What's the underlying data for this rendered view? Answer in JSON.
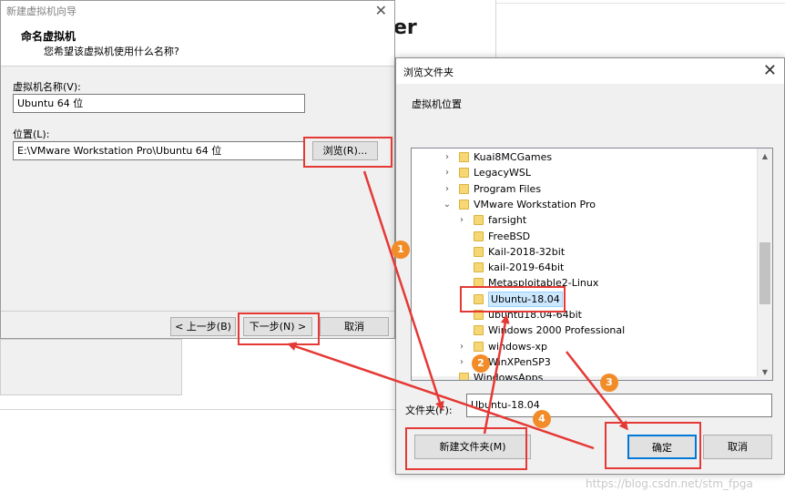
{
  "background": {
    "heading_fragment": "er"
  },
  "wizard": {
    "title": "新建虚拟机向导",
    "header_title": "命名虚拟机",
    "header_subtitle": "您希望该虚拟机使用什么名称?",
    "name_label": "虚拟机名称(V):",
    "name_value": "Ubuntu 64 位",
    "location_label": "位置(L):",
    "location_value": "E:\\VMware Workstation Pro\\Ubuntu 64 位",
    "browse_button": "浏览(R)...",
    "back_button": "< 上一步(B)",
    "next_button": "下一步(N) >",
    "cancel_button": "取消"
  },
  "browse_dialog": {
    "title": "浏览文件夹",
    "description": "虚拟机位置",
    "tree": [
      {
        "label": "Kuai8MCGames",
        "level": 0,
        "expander": "collapsed"
      },
      {
        "label": "LegacyWSL",
        "level": 0,
        "expander": "collapsed"
      },
      {
        "label": "Program Files",
        "level": 0,
        "expander": "collapsed"
      },
      {
        "label": "VMware Workstation Pro",
        "level": 0,
        "expander": "expanded"
      },
      {
        "label": "farsight",
        "level": 1,
        "expander": "collapsed"
      },
      {
        "label": "FreeBSD",
        "level": 1,
        "expander": "none"
      },
      {
        "label": "Kail-2018-32bit",
        "level": 1,
        "expander": "none"
      },
      {
        "label": "kail-2019-64bit",
        "level": 1,
        "expander": "none"
      },
      {
        "label": "Metasploitable2-Linux",
        "level": 1,
        "expander": "none"
      },
      {
        "label": "Ubuntu-18.04",
        "level": 1,
        "expander": "none",
        "selected": true
      },
      {
        "label": "ubuntu18.04-64bit",
        "level": 1,
        "expander": "none"
      },
      {
        "label": "Windows 2000 Professional",
        "level": 1,
        "expander": "none"
      },
      {
        "label": "windows-xp",
        "level": 1,
        "expander": "collapsed"
      },
      {
        "label": "WinXPenSP3",
        "level": 1,
        "expander": "collapsed"
      },
      {
        "label": "WindowsApps",
        "level": 0,
        "expander": "none"
      }
    ],
    "folder_label": "文件夹(F):",
    "folder_value": "Ubuntu-18.04",
    "new_folder_button": "新建文件夹(M)",
    "ok_button": "确定",
    "cancel_button": "取消"
  },
  "annotations": {
    "accent_color": "#e53935",
    "badge_color": "#f28c28",
    "badges": [
      "1",
      "2",
      "3",
      "4"
    ]
  },
  "watermark": "https://blog.csdn.net/stm_fpga"
}
